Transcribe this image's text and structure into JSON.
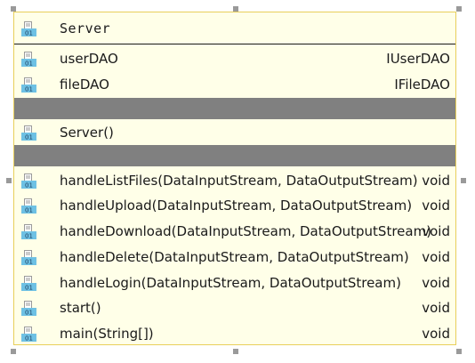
{
  "class_name": "Server",
  "fields": [
    {
      "name": "userDAO",
      "type": "IUserDAO",
      "icon": "field-icon"
    },
    {
      "name": "fileDAO",
      "type": "IFileDAO",
      "icon": "field-icon"
    }
  ],
  "constructors": [
    {
      "name": "Server()",
      "type": "",
      "icon": "constructor-icon"
    }
  ],
  "methods": [
    {
      "name": "handleListFiles(DataInputStream, DataOutputStream)",
      "type": "void",
      "icon": "method-icon"
    },
    {
      "name": "handleUpload(DataInputStream, DataOutputStream)",
      "type": "void",
      "icon": "method-icon"
    },
    {
      "name": "handleDownload(DataInputStream, DataOutputStream)",
      "type": "void",
      "icon": "method-icon"
    },
    {
      "name": "handleDelete(DataInputStream, DataOutputStream)",
      "type": "void",
      "icon": "method-icon"
    },
    {
      "name": "handleLogin(DataInputStream, DataOutputStream)",
      "type": "void",
      "icon": "method-icon"
    },
    {
      "name": "start()",
      "type": "void",
      "icon": "method-icon"
    },
    {
      "name": "main(String[])",
      "type": "void",
      "icon": "method-icon"
    }
  ],
  "icon_label": "01",
  "colors": {
    "background": "#ffffe8",
    "border": "#e8cf5a",
    "separator": "#808080",
    "icon_fill": "#6ec1e4",
    "icon_outline": "#9a9a9a"
  }
}
